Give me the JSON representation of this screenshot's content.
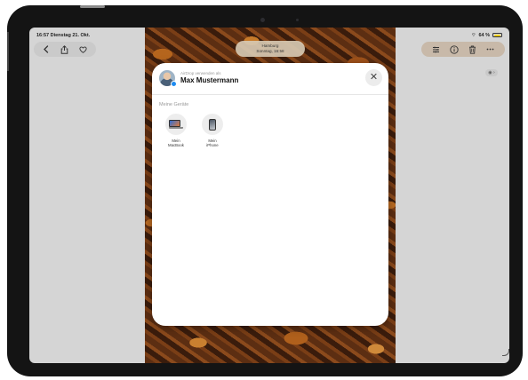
{
  "status_bar": {
    "time_date": "16:57  Dienstag 21. Okt.",
    "battery": "64 %"
  },
  "location_pill": {
    "place": "Hamburg",
    "date": "Sonntag, 16:58"
  },
  "toolbar_left": {
    "back_icon": "chevron-left-icon",
    "share_icon": "share-icon",
    "favorite_icon": "heart-icon"
  },
  "toolbar_right": {
    "adjust_icon": "sliders-icon",
    "info_icon": "info-icon",
    "delete_icon": "trash-icon",
    "more_icon": "ellipsis-icon"
  },
  "airdrop_sheet": {
    "subtitle": "AirDrop verwenden als",
    "user_name": "Max Mustermann",
    "section_title": "Meine Geräte",
    "devices": [
      {
        "line1": "Mein",
        "line2": "MacBook"
      },
      {
        "line1": "Mein",
        "line2": "iPhone"
      }
    ]
  },
  "colors": {
    "battery": "#f1d11a",
    "sheet_background": "#ffffff",
    "screen_gray": "#d5d5d5"
  }
}
